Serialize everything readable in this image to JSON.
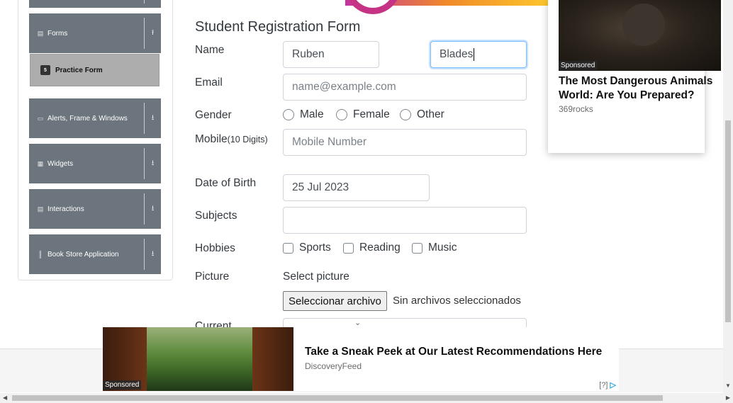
{
  "sidebar": {
    "groups": [
      {
        "label": "Forms",
        "icon": "list-icon",
        "arrow": "⭱"
      },
      {
        "label": "Alerts, Frame & Windows",
        "icon": "window-icon",
        "arrow": "⭳"
      },
      {
        "label": "Widgets",
        "icon": "grid-icon",
        "arrow": "⭳"
      },
      {
        "label": "Interactions",
        "icon": "list-icon",
        "arrow": "⭳"
      },
      {
        "label": "Book Store Application",
        "icon": "books-icon",
        "arrow": "⭳"
      }
    ],
    "active_item": {
      "label": "Practice Form",
      "icon": "html5-icon"
    }
  },
  "form": {
    "title": "Student Registration Form",
    "name_label": "Name",
    "first_name": "Ruben",
    "last_name": "Blades",
    "email_label": "Email",
    "email_placeholder": "name@example.com",
    "gender_label": "Gender",
    "gender_options": [
      "Male",
      "Female",
      "Other"
    ],
    "mobile_label": "Mobile",
    "mobile_hint": "(10 Digits)",
    "mobile_placeholder": "Mobile Number",
    "dob_label": "Date of Birth",
    "dob_value": "25 Jul 2023",
    "subjects_label": "Subjects",
    "hobbies_label": "Hobbies",
    "hobby_options": [
      "Sports",
      "Reading",
      "Music"
    ],
    "picture_label": "Picture",
    "select_picture": "Select picture",
    "file_button": "Seleccionar archivo",
    "file_status": "Sin archivos seleccionados",
    "current_label": "Current"
  },
  "ad_right": {
    "sponsored": "Sponsored",
    "title": "The Most Dangerous Animals World: Are You Prepared?",
    "source": "369rocks"
  },
  "ad_bottom": {
    "sponsored": "Sponsored",
    "title": "Take a Sneak Peek at Our Latest Recommendations Here",
    "source": "DiscoveryFeed",
    "adchoice": "[?]"
  }
}
